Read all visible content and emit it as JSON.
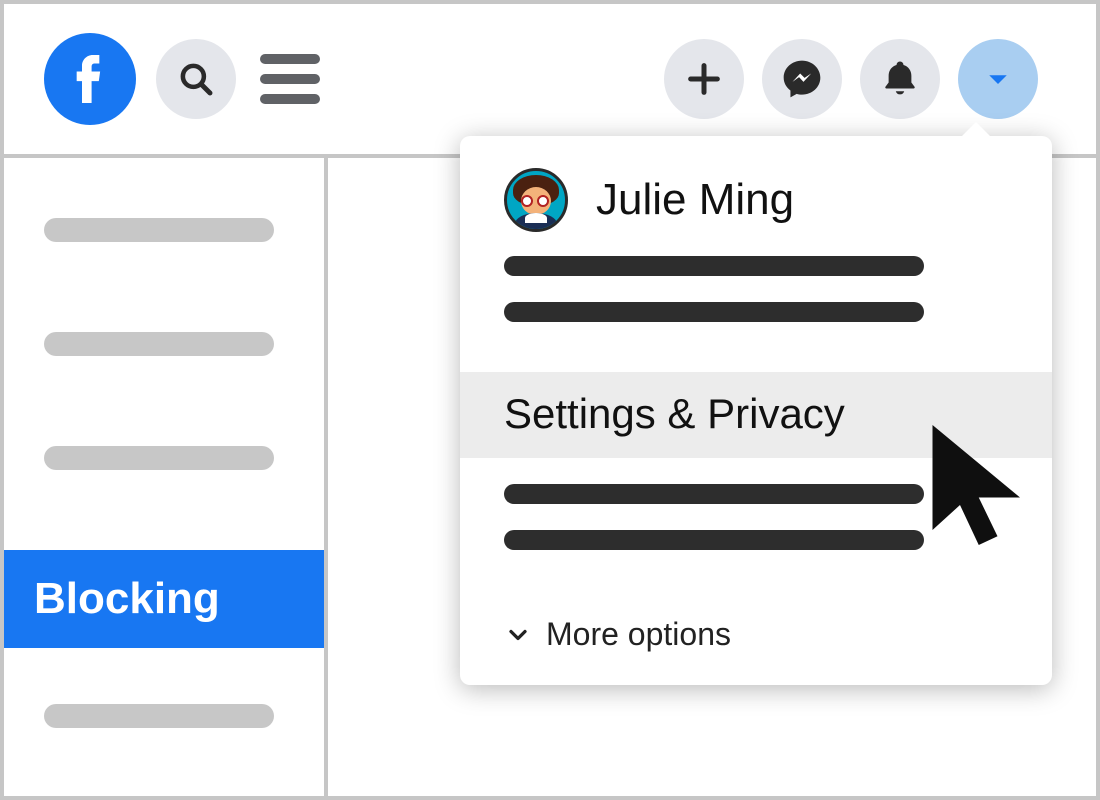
{
  "topbar": {
    "logo": "facebook",
    "icons": {
      "search": "search-icon",
      "menu": "hamburger-icon",
      "create": "plus-icon",
      "messenger": "messenger-icon",
      "notifications": "bell-icon",
      "account": "caret-down-icon"
    }
  },
  "sidebar": {
    "active_label": "Blocking"
  },
  "dropdown": {
    "profile_name": "Julie Ming",
    "settings_label": "Settings & Privacy",
    "more_label": "More options"
  }
}
